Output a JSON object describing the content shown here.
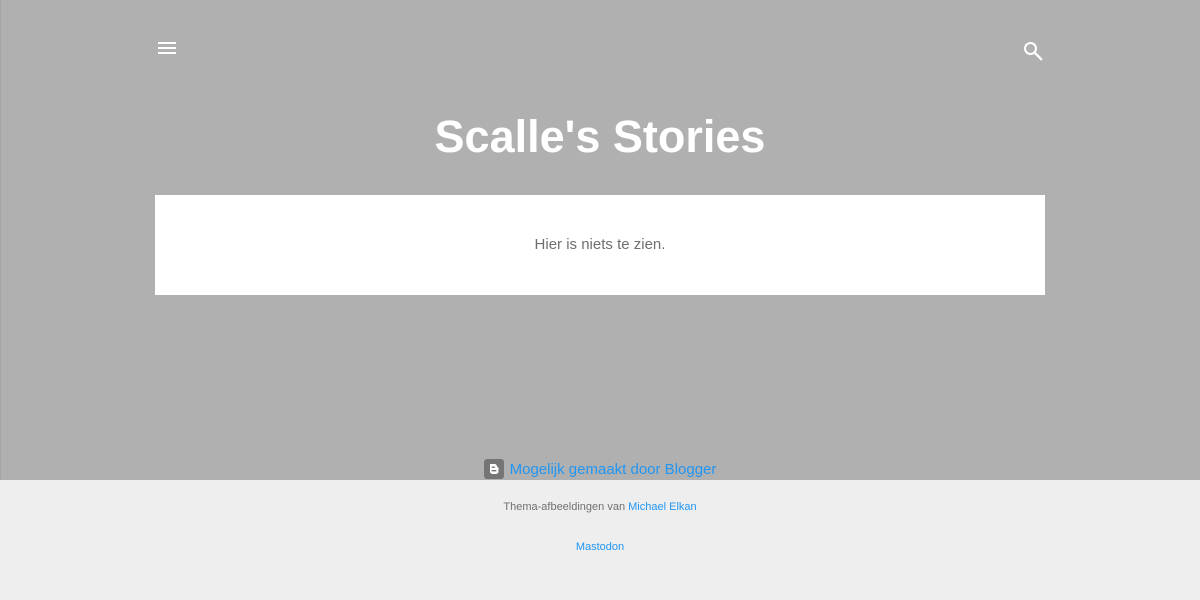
{
  "header": {
    "title": "Scalle's Stories",
    "menu_icon": "hamburger-menu-icon",
    "search_icon": "search-icon"
  },
  "main": {
    "empty_message": "Hier is niets te zien."
  },
  "footer": {
    "powered_by": "Mogelijk gemaakt door Blogger",
    "blogger_icon": "blogger-icon",
    "attribution_prefix": "Thema-afbeeldingen van",
    "attribution_author": "Michael Elkan",
    "mastodon_link": "Mastodon"
  },
  "colors": {
    "header_background": "#b0b0b0",
    "page_background": "#eeeeee",
    "card_background": "#ffffff",
    "link": "#2196f3"
  }
}
